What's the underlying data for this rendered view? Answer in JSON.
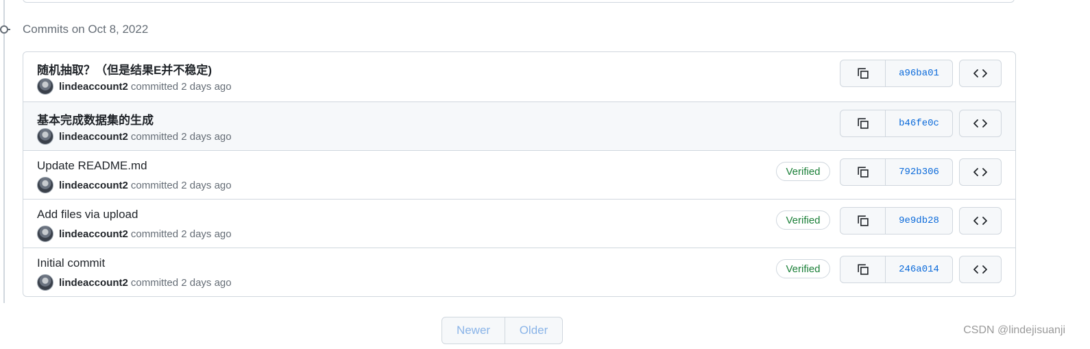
{
  "group": {
    "title": "Commits on Oct 8, 2022"
  },
  "commits": [
    {
      "message": "随机抽取？（但是结果E并不稳定)",
      "author": "lindeaccount2",
      "time": "committed 2 days ago",
      "verified": "",
      "sha": "a96ba01"
    },
    {
      "message": "基本完成数据集的生成",
      "author": "lindeaccount2",
      "time": "committed 2 days ago",
      "verified": "",
      "sha": "b46fe0c"
    },
    {
      "message": "Update README.md",
      "author": "lindeaccount2",
      "time": "committed 2 days ago",
      "verified": "Verified",
      "sha": "792b306"
    },
    {
      "message": "Add files via upload",
      "author": "lindeaccount2",
      "time": "committed 2 days ago",
      "verified": "Verified",
      "sha": "9e9db28"
    },
    {
      "message": "Initial commit",
      "author": "lindeaccount2",
      "time": "committed 2 days ago",
      "verified": "Verified",
      "sha": "246a014"
    }
  ],
  "pagination": {
    "newer": "Newer",
    "older": "Older"
  },
  "watermark": "CSDN @lindejisuanji",
  "icons": {
    "copy": "copy-icon",
    "browse": "code-icon",
    "commit": "git-commit-icon"
  },
  "colors": {
    "verified": "#1a7f37",
    "sha": "#0969da",
    "border": "#d0d7de"
  }
}
